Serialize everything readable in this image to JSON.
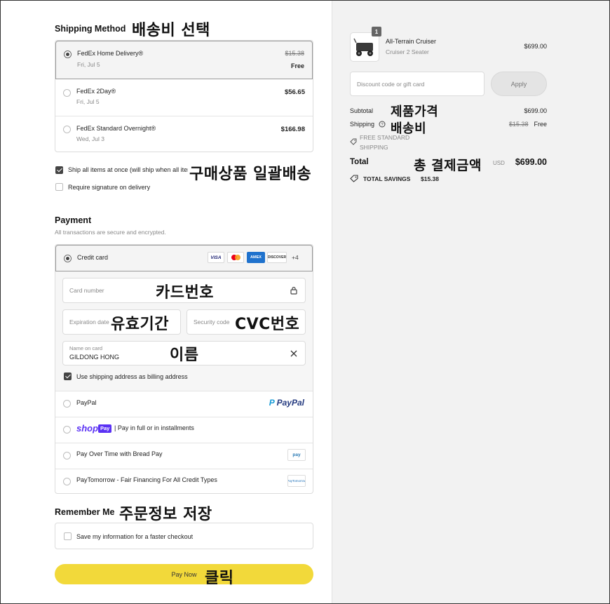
{
  "shipping": {
    "title": "Shipping Method",
    "annotation": "배송비 선택",
    "options": [
      {
        "name": "FedEx Home Delivery®",
        "date": "Fri, Jul 5",
        "old_price": "$15.38",
        "price": "Free",
        "selected": true
      },
      {
        "name": "FedEx 2Day®",
        "date": "Fri, Jul 5",
        "price": "$56.65",
        "selected": false
      },
      {
        "name": "FedEx Standard Overnight®",
        "date": "Wed, Jul 3",
        "price": "$166.98",
        "selected": false
      }
    ],
    "ship_all_label": "Ship all items at once (will ship when all items are available)",
    "ship_all_annotation": "구매상품 일괄배송",
    "signature_label": "Require signature on delivery"
  },
  "payment": {
    "title": "Payment",
    "subtitle": "All transactions are secure and encrypted.",
    "credit_card_label": "Credit card",
    "card_logos": [
      "VISA",
      "MC",
      "AMEX",
      "DISCOVER"
    ],
    "more_logos": "+4",
    "card_number_placeholder": "Card number",
    "card_number_annotation": "카드번호",
    "expiration_placeholder": "Expiration date",
    "expiration_annotation": "유효기간",
    "security_placeholder": "Security code",
    "security_annotation": "CVC번호",
    "name_label": "Name on card",
    "name_value": "GILDONG HONG",
    "name_annotation": "이름",
    "billing_label": "Use shipping address as billing address",
    "paypal_label": "PayPal",
    "paypal_logo": "PayPal",
    "shoppay_logo": "shop",
    "shoppay_badge": "Pay",
    "shoppay_label": "| Pay in full or in installments",
    "bread_label": "Pay Over Time with Bread Pay",
    "bread_logo": "pay",
    "paytomorrow_label": "PayTomorrow - Fair Financing For All Credit Types",
    "paytomorrow_logo": "PayTomorrow"
  },
  "remember": {
    "title": "Remember Me",
    "annotation": "주문정보 저장",
    "save_label": "Save my information for a faster checkout"
  },
  "pay_button": {
    "label": "Pay Now",
    "annotation": "클릭"
  },
  "summary": {
    "qty": "1",
    "product_name": "All-Terrain Cruiser",
    "product_variant": "Cruiser 2 Seater",
    "product_price": "$699.00",
    "discount_placeholder": "Discount code or gift card",
    "apply_label": "Apply",
    "subtotal_label": "Subtotal",
    "subtotal_annotation": "제품가격",
    "subtotal_value": "$699.00",
    "shipping_label": "Shipping",
    "shipping_annotation": "배송비",
    "shipping_old": "$15.38",
    "shipping_value": "Free",
    "free_shipping_label": "FREE STANDARD SHIPPING",
    "total_label": "Total",
    "total_annotation": "총 결제금액",
    "currency": "USD",
    "total_value": "$699.00",
    "savings_label": "TOTAL SAVINGS",
    "savings_value": "$15.38"
  },
  "colors": {
    "pay_button": "#f2d93a",
    "shop_purple": "#5a31f4",
    "paypal_blue": "#253b80",
    "summary_bg": "#f2f2f2"
  }
}
